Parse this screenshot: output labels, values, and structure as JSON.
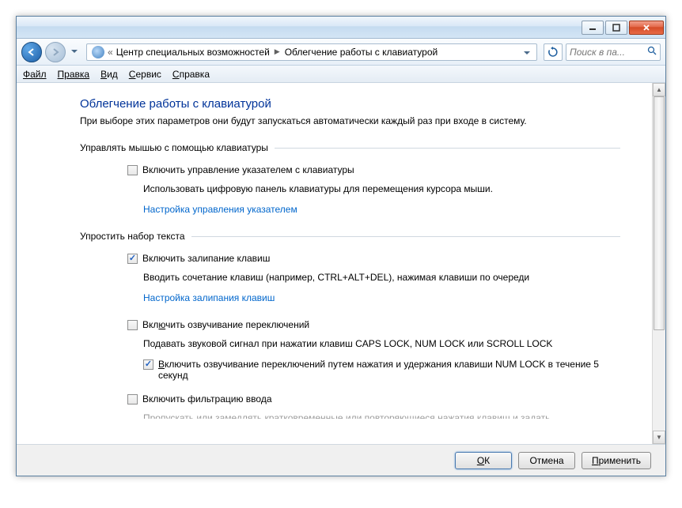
{
  "breadcrumb": {
    "parent": "Центр специальных возможностей",
    "current": "Облегчение работы с клавиатурой"
  },
  "search": {
    "placeholder": "Поиск в па..."
  },
  "menu": {
    "file": "Файл",
    "edit": "Правка",
    "view": "Вид",
    "tools": "Сервис",
    "help": "Справка"
  },
  "page": {
    "title": "Облегчение работы с клавиатурой",
    "desc": "При выборе этих параметров они будут запускаться автоматически каждый раз при входе в систему."
  },
  "sections": {
    "mouse": {
      "heading": "Управлять мышью с помощью клавиатуры",
      "opt1_label": "Включить управление указателем с клавиатуры",
      "opt1_checked": false,
      "opt1_desc": "Использовать цифровую панель клавиатуры для перемещения курсора мыши.",
      "link": "Настройка управления указателем"
    },
    "typing": {
      "heading": "Упростить набор текста",
      "sticky_label": "Включить залипание клавиш",
      "sticky_checked": true,
      "sticky_desc": "Вводить сочетание клавиш (например, CTRL+ALT+DEL), нажимая клавиши по очереди",
      "sticky_link": "Настройка залипания клавиш",
      "toggle_label": "Включить озвучивание переключений",
      "toggle_checked": false,
      "toggle_desc": "Подавать звуковой сигнал при нажатии клавиш CAPS LOCK, NUM LOCK или SCROLL LOCK",
      "toggle_sub_label": "Включить озвучивание переключений путем нажатия и удержания клавиши NUM LOCK в течение 5 секунд",
      "toggle_sub_checked": true,
      "filter_label": "Включить фильтрацию ввода",
      "filter_checked": false,
      "filter_desc_partial": "Пропускать или замедлять кратковременные или повторяющиеся нажатия клавиш и задать"
    }
  },
  "buttons": {
    "ok": "ОК",
    "cancel": "Отмена",
    "apply": "Применить"
  }
}
